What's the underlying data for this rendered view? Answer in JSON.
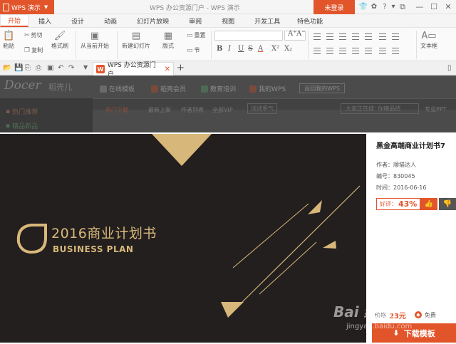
{
  "titlebar": {
    "app_menu_label": "WPS 演示",
    "title": "WPS 办公资源门户 - WPS 演示",
    "login_label": "未登录",
    "icons": [
      "shirt-icon",
      "skin-icon",
      "help-icon",
      "minimize-ribbon-icon",
      "window-restore-icon",
      "minimize-icon",
      "maximize-icon",
      "close-icon"
    ]
  },
  "tabs": [
    "开始",
    "插入",
    "设计",
    "动画",
    "幻灯片放映",
    "审阅",
    "视图",
    "开发工具",
    "特色功能"
  ],
  "ribbon": {
    "paste": "粘贴",
    "cut": "剪切",
    "copy": "复制",
    "format_painter": "格式刷",
    "from_current": "从当前开始",
    "new_slide": "新建幻灯片",
    "layout": "版式",
    "reset": "重置",
    "section": "节",
    "text_box": "文本框",
    "format_buttons": [
      "B",
      "I",
      "U",
      "S",
      "A",
      "X²",
      "X₂"
    ],
    "font_size_buttons": [
      "A⁺",
      "A⁻"
    ]
  },
  "doc_tab": {
    "label": "WPS 办公资源门户"
  },
  "docer": {
    "logo": "Docer",
    "logo_cn": "稻壳儿",
    "nav": [
      "在线模板",
      "稻壳会员",
      "教育培训",
      "我的WPS"
    ],
    "register_label": "返回我的WPS",
    "sidebar": [
      "热门推荐",
      "精品新品"
    ],
    "subnav": [
      "热门下载",
      "最新上架",
      "作者列表",
      "全部VIP"
    ],
    "search_mode": "试试手气",
    "search_placeholder": "大家正在搜: 你精品结",
    "ppt_label": "专业PPT"
  },
  "slide": {
    "title": "2016商业计划书",
    "subtitle": "BUSINESS PLAN",
    "colors": {
      "background": "#221f1e",
      "gold": "#d8b77a"
    }
  },
  "info": {
    "title": "黑金高端商业计划书7",
    "author": "作者：顺猫达人",
    "number": "编号：830045",
    "date": "时间：2016-06-16",
    "rating_label": "好评：",
    "rating_value": "43%",
    "price_label": "价格",
    "price_value": "23元",
    "free_label": "免费",
    "download_label": "下载模板"
  },
  "watermark": {
    "brand": "Bai 经验",
    "url": "jingyan.baidu.com"
  }
}
